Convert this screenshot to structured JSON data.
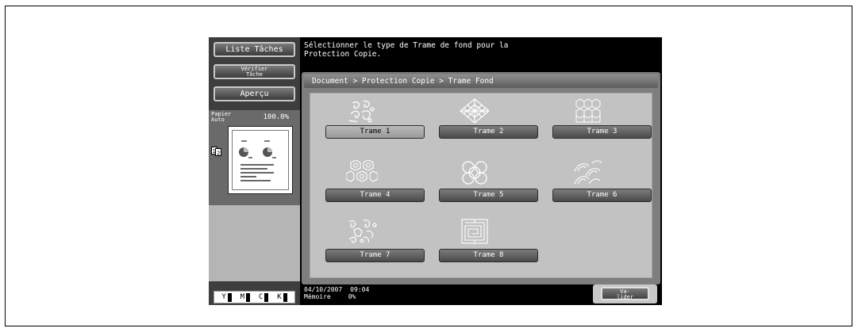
{
  "left": {
    "job_list_label": "Liste Tâches",
    "verify_label": "Vérifier Tâche",
    "preview_label": "Aperçu",
    "paper_label": "Papier Auto",
    "zoom": "100.0%",
    "toner": [
      "Y",
      "M",
      "C",
      "K"
    ]
  },
  "message": "Sélectionner le type de Trame de fond pour la\nProtection Copie.",
  "breadcrumb": "Document   > Protection Copie > Trame Fond",
  "options": [
    {
      "label": "Trame 1",
      "icon": "swirl-pattern-icon",
      "selected": true
    },
    {
      "label": "Trame 2",
      "icon": "diamond-lattice-pattern-icon",
      "selected": false
    },
    {
      "label": "Trame 3",
      "icon": "hexagon-pattern-icon",
      "selected": false
    },
    {
      "label": "Trame 4",
      "icon": "hex-flower-pattern-icon",
      "selected": false
    },
    {
      "label": "Trame 5",
      "icon": "circle-ring-pattern-icon",
      "selected": false
    },
    {
      "label": "Trame 6",
      "icon": "wave-pattern-icon",
      "selected": false
    },
    {
      "label": "Trame 7",
      "icon": "arabesque-pattern-icon",
      "selected": false
    },
    {
      "label": "Trame 8",
      "icon": "maze-pattern-icon",
      "selected": false
    }
  ],
  "status": {
    "date": "04/10/2007",
    "time": "09:04",
    "memory_label": "Mémoire",
    "memory_value": "0%"
  },
  "valider_label": "Valider"
}
